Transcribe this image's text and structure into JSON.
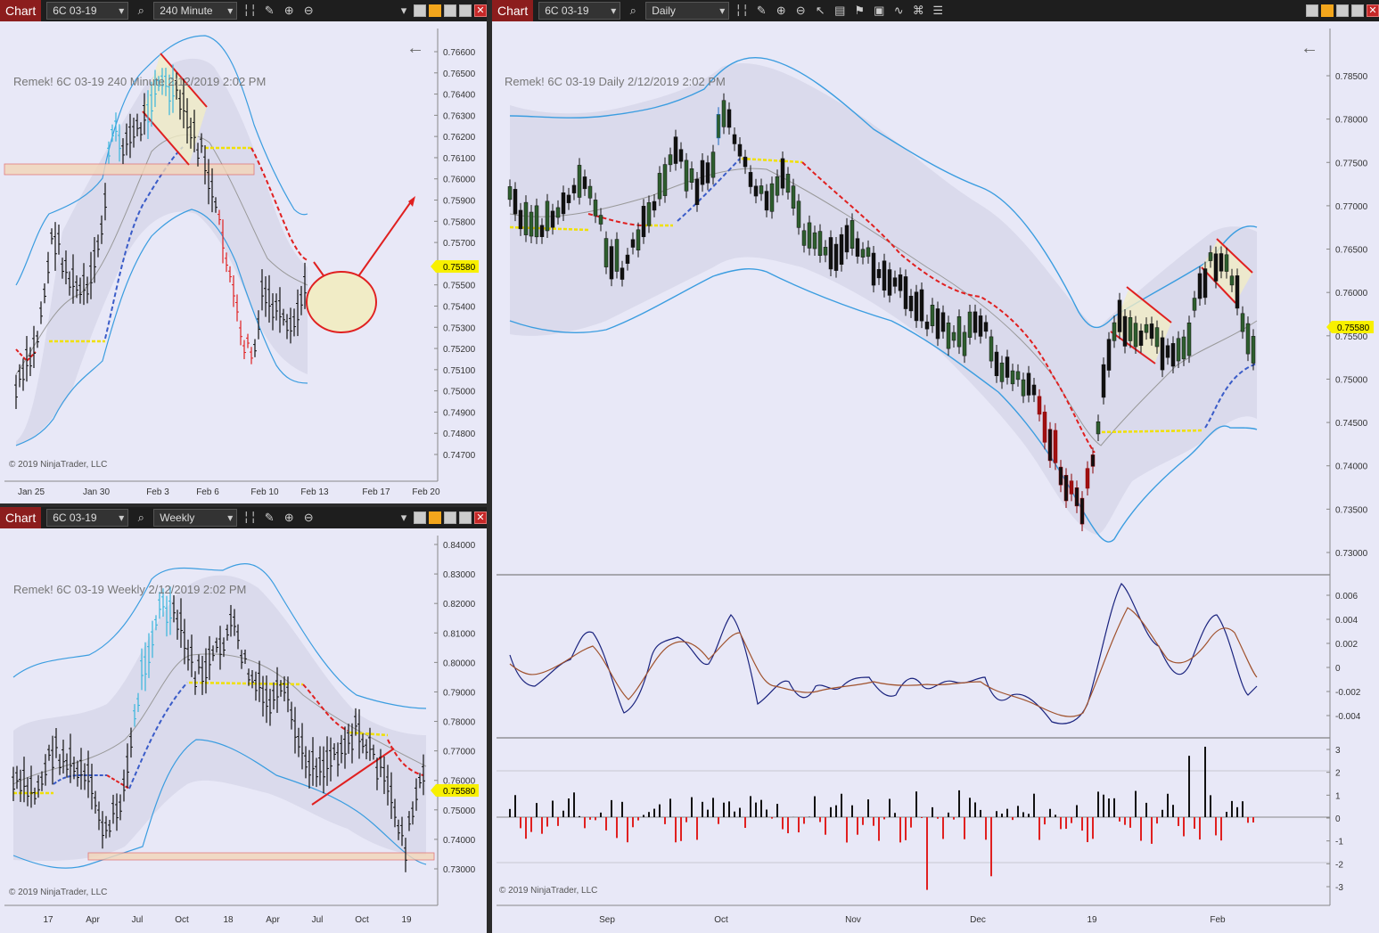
{
  "colors": {
    "bg": "#e8e8f7",
    "band": "#3b9de0",
    "red": "#e02020",
    "yellow": "#f0e000",
    "blue": "#3a5cc8",
    "price_tag": "#f8f000"
  },
  "copyright": "© 2019 NinjaTrader, LLC",
  "win1": {
    "chart_label": "Chart",
    "instrument": "6C 03-19",
    "period": "240 Minute",
    "title": "Remek!  6C 03-19  240 Minute  2/12/2019 2:02 PM",
    "price_tag": "0.75580",
    "y_ticks": [
      "0.76600",
      "0.76500",
      "0.76400",
      "0.76300",
      "0.76200",
      "0.76100",
      "0.76000",
      "0.75900",
      "0.75800",
      "0.75700",
      "0.75600",
      "0.75500",
      "0.75400",
      "0.75300",
      "0.75200",
      "0.75100",
      "0.75000",
      "0.74900",
      "0.74800",
      "0.74700"
    ],
    "x_ticks": [
      "Jan 25",
      "Jan 30",
      "Feb 3",
      "Feb 6",
      "Feb 10",
      "Feb 13",
      "Feb 17",
      "Feb 20"
    ]
  },
  "win2": {
    "chart_label": "Chart",
    "instrument": "6C 03-19",
    "period": "Weekly",
    "title": "Remek!  6C 03-19  Weekly  2/12/2019 2:02 PM",
    "price_tag": "0.75580",
    "y_ticks": [
      "0.84000",
      "0.83000",
      "0.82000",
      "0.81000",
      "0.80000",
      "0.79000",
      "0.78000",
      "0.77000",
      "0.76000",
      "0.75000",
      "0.74000",
      "0.73000"
    ],
    "x_ticks": [
      "17",
      "Apr",
      "Jul",
      "Oct",
      "18",
      "Apr",
      "Jul",
      "Oct",
      "19"
    ]
  },
  "win3": {
    "chart_label": "Chart",
    "instrument": "6C 03-19",
    "period": "Daily",
    "title": "Remek!  6C 03-19  Daily  2/12/2019 2:02 PM",
    "price_tag": "0.75580",
    "y_ticks": [
      "0.78500",
      "0.78000",
      "0.77500",
      "0.77000",
      "0.76500",
      "0.76000",
      "0.75500",
      "0.75000",
      "0.74500",
      "0.74000",
      "0.73500",
      "0.73000"
    ],
    "osc_ticks": [
      "0.006",
      "0.004",
      "0.002",
      "0",
      "-0.002",
      "-0.004"
    ],
    "hist_ticks": [
      "3",
      "2",
      "1",
      "0",
      "-1",
      "-2",
      "-3"
    ],
    "x_ticks": [
      "Sep",
      "Oct",
      "Nov",
      "Dec",
      "19",
      "Feb"
    ]
  }
}
